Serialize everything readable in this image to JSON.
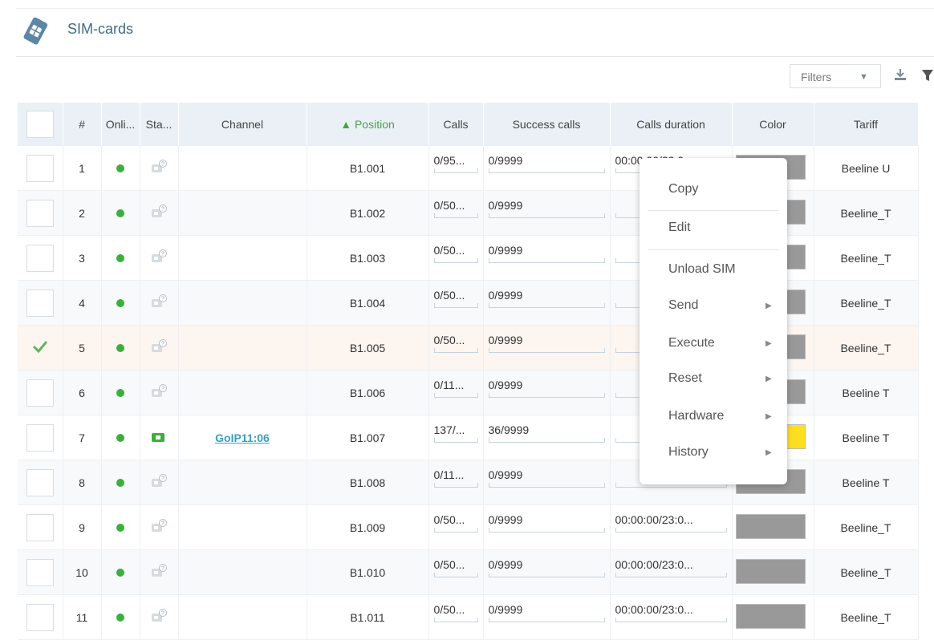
{
  "header": {
    "title": "SIM-cards"
  },
  "toolbar": {
    "filters_label": "Filters",
    "filters_caret": "▼"
  },
  "icons": {
    "sim": "sim-card-icon",
    "download": "download-icon",
    "filter": "filter-icon",
    "status": "sim-unknown-icon",
    "status_active": "sim-active-icon",
    "check": "checkmark-icon"
  },
  "colors": {
    "online": "#3cae3c",
    "swatch_gray": "#999999",
    "swatch_yellow": "#ffe020",
    "link": "#3a9ec0",
    "sort_arrow": "#49a34a"
  },
  "columns": {
    "num": "#",
    "online": "Onli...",
    "status": "Sta...",
    "channel": "Channel",
    "position": "▲ Position",
    "calls": "Calls",
    "success": "Success calls",
    "duration": "Calls duration",
    "color": "Color",
    "tariff": "Tariff"
  },
  "rows": [
    {
      "num": "1",
      "channel": "",
      "position": "B1.001",
      "calls": "0/95...",
      "success": "0/9999",
      "duration": "00:00:00/23:0...",
      "tariff": "Beeline U"
    },
    {
      "num": "2",
      "channel": "",
      "position": "B1.002",
      "calls": "0/50...",
      "success": "0/9999",
      "duration": "",
      "tariff": "Beeline_T"
    },
    {
      "num": "3",
      "channel": "",
      "position": "B1.003",
      "calls": "0/50...",
      "success": "0/9999",
      "duration": "",
      "tariff": "Beeline_T"
    },
    {
      "num": "4",
      "channel": "",
      "position": "B1.004",
      "calls": "0/50...",
      "success": "0/9999",
      "duration": "",
      "tariff": "Beeline_T"
    },
    {
      "num": "5",
      "channel": "",
      "position": "B1.005",
      "calls": "0/50...",
      "success": "0/9999",
      "duration": "",
      "tariff": "Beeline_T"
    },
    {
      "num": "6",
      "channel": "",
      "position": "B1.006",
      "calls": "0/11...",
      "success": "0/9999",
      "duration": "",
      "tariff": "Beeline T"
    },
    {
      "num": "7",
      "channel": "GoIP11:06",
      "position": "B1.007",
      "calls": "137/...",
      "success": "36/9999",
      "duration": "",
      "tariff": "Beeline T"
    },
    {
      "num": "8",
      "channel": "",
      "position": "B1.008",
      "calls": "0/11...",
      "success": "0/9999",
      "duration": "",
      "tariff": "Beeline T"
    },
    {
      "num": "9",
      "channel": "",
      "position": "B1.009",
      "calls": "0/50...",
      "success": "0/9999",
      "duration": "00:00:00/23:0...",
      "tariff": "Beeline_T"
    },
    {
      "num": "10",
      "channel": "",
      "position": "B1.010",
      "calls": "0/50...",
      "success": "0/9999",
      "duration": "00:00:00/23:0...",
      "tariff": "Beeline_T"
    },
    {
      "num": "11",
      "channel": "",
      "position": "B1.011",
      "calls": "0/50...",
      "success": "0/9999",
      "duration": "00:00:00/23:0...",
      "tariff": "Beeline_T"
    }
  ],
  "context_menu": {
    "copy": "Copy",
    "edit": "Edit",
    "unload": "Unload SIM",
    "send": "Send",
    "execute": "Execute",
    "reset": "Reset",
    "hardware": "Hardware",
    "history": "History",
    "submenu_arrow": "▶"
  }
}
